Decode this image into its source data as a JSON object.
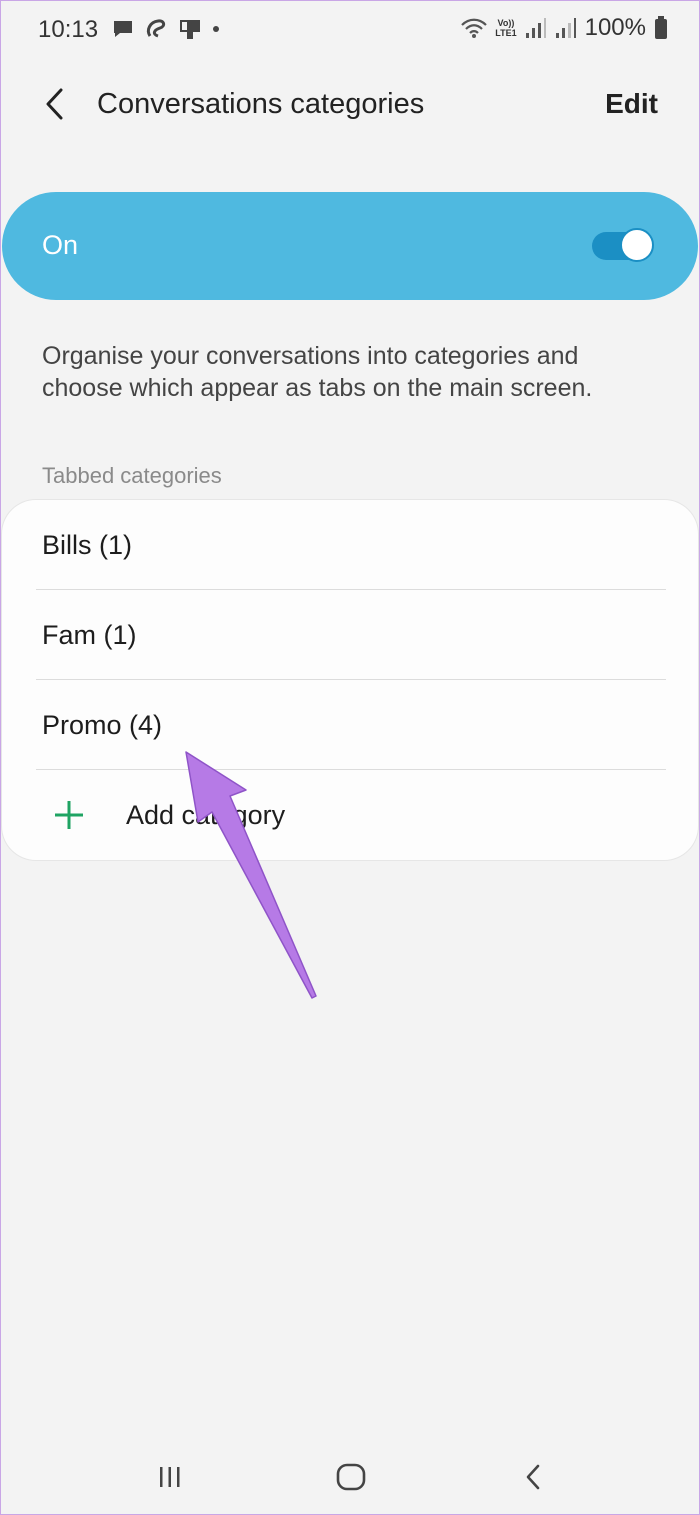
{
  "status_bar": {
    "time": "10:13",
    "volte_line1": "Vo))",
    "volte_line2": "LTE1",
    "battery": "100%",
    "notification_icons": [
      "message-icon",
      "airtel-icon",
      "device-icon",
      "dot-icon"
    ]
  },
  "app_bar": {
    "title": "Conversations categories",
    "edit_label": "Edit"
  },
  "master_switch": {
    "label": "On",
    "state": "on",
    "color": "#4fb9e0"
  },
  "description": "Organise your conversations into categories and choose which appear as tabs on the main screen.",
  "tabbed_section": {
    "header": "Tabbed categories",
    "items": [
      {
        "label": "Bills (1)"
      },
      {
        "label": "Fam (1)"
      },
      {
        "label": "Promo (4)"
      }
    ],
    "add_label": "Add category"
  },
  "colors": {
    "accent": "#4fb9e0",
    "add_icon": "#1fa463",
    "annotation_arrow": "#b67ae6"
  },
  "nav_bar": {
    "buttons": [
      "recents-icon",
      "home-icon",
      "back-icon"
    ]
  }
}
